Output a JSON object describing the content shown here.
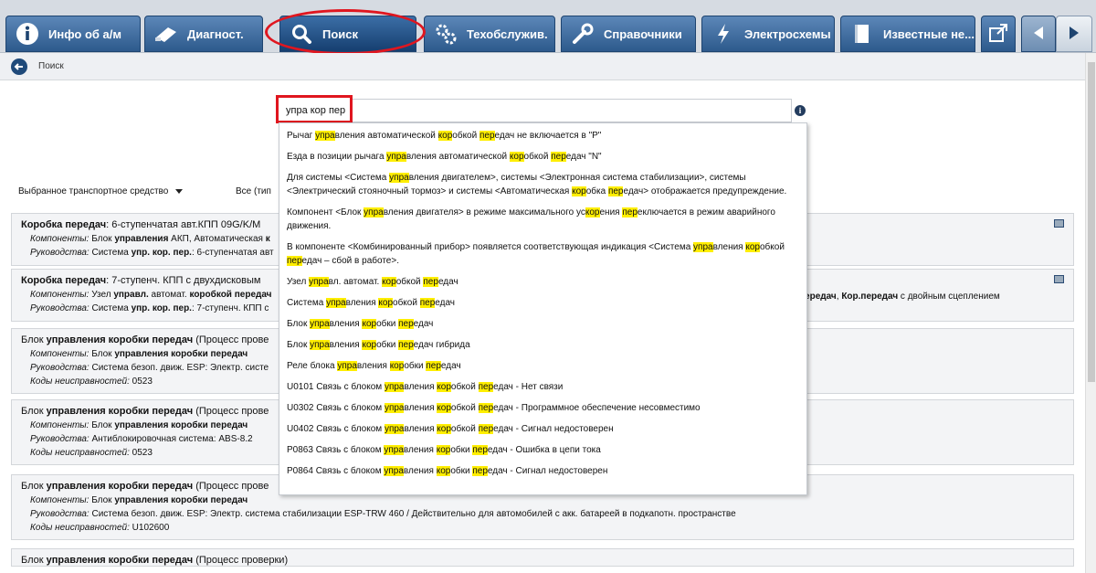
{
  "tabs": [
    {
      "id": "info",
      "label": "Инфо об а/м",
      "icon": "info-icon"
    },
    {
      "id": "diag",
      "label": "Диагност.",
      "icon": "diagnostic-connector-icon"
    },
    {
      "id": "search",
      "label": "Поиск",
      "icon": "search-icon",
      "active": true
    },
    {
      "id": "service",
      "label": "Техобслужив.",
      "icon": "gears-icon"
    },
    {
      "id": "refs",
      "label": "Справочники",
      "icon": "wrench-icon"
    },
    {
      "id": "wiring",
      "label": "Электросхемы",
      "icon": "lightning-icon"
    },
    {
      "id": "known",
      "label": "Известные не...",
      "icon": "book-icon"
    }
  ],
  "subbar": {
    "breadcrumb": "Поиск"
  },
  "search": {
    "value": "упра кор пер"
  },
  "filters": {
    "vehicle": "Выбранное транспортное средство",
    "type": "Все (тип"
  },
  "suggestions": [
    [
      [
        "Рычаг ",
        0
      ],
      [
        "упра",
        1
      ],
      [
        "вления автоматической ",
        0
      ],
      [
        "кор",
        1
      ],
      [
        "обкой ",
        0
      ],
      [
        "пер",
        1
      ],
      [
        "едач не включается в \"P\"",
        0
      ]
    ],
    [
      [
        "Езда в позиции рычага ",
        0
      ],
      [
        "упра",
        1
      ],
      [
        "вления автоматической ",
        0
      ],
      [
        "кор",
        1
      ],
      [
        "обкой ",
        0
      ],
      [
        "пер",
        1
      ],
      [
        "едач \"N\"",
        0
      ]
    ],
    [
      [
        "Для системы <Система ",
        0
      ],
      [
        "упра",
        1
      ],
      [
        "вления двигателем>, системы <Электронная система стабилизации>, системы <Электрический стояночный тормоз> и системы <Автоматическая ",
        0
      ],
      [
        "кор",
        1
      ],
      [
        "обка ",
        0
      ],
      [
        "пер",
        1
      ],
      [
        "едач> отображается предупреждение.",
        0
      ]
    ],
    [
      [
        "Компонент <Блок ",
        0
      ],
      [
        "упра",
        1
      ],
      [
        "вления двигателя> в режиме максимального ус",
        0
      ],
      [
        "кор",
        1
      ],
      [
        "ения ",
        0
      ],
      [
        "пер",
        1
      ],
      [
        "еключается в режим аварийного движения.",
        0
      ]
    ],
    [
      [
        "В компоненте <Комбинированный прибор> появляется соответствующая индикация <Система ",
        0
      ],
      [
        "упра",
        1
      ],
      [
        "вления ",
        0
      ],
      [
        "кор",
        1
      ],
      [
        "обкой ",
        0
      ],
      [
        "пер",
        1
      ],
      [
        "едач – сбой в работе>.",
        0
      ]
    ],
    [
      [
        "Узел ",
        0
      ],
      [
        "упра",
        1
      ],
      [
        "вл. автомат. ",
        0
      ],
      [
        "кор",
        1
      ],
      [
        "обкой ",
        0
      ],
      [
        "пер",
        1
      ],
      [
        "едач",
        0
      ]
    ],
    [
      [
        "Система ",
        0
      ],
      [
        "упра",
        1
      ],
      [
        "вления ",
        0
      ],
      [
        "кор",
        1
      ],
      [
        "обкой ",
        0
      ],
      [
        "пер",
        1
      ],
      [
        "едач",
        0
      ]
    ],
    [
      [
        "Блок ",
        0
      ],
      [
        "упра",
        1
      ],
      [
        "вления ",
        0
      ],
      [
        "кор",
        1
      ],
      [
        "обки ",
        0
      ],
      [
        "пер",
        1
      ],
      [
        "едач",
        0
      ]
    ],
    [
      [
        "Блок ",
        0
      ],
      [
        "упра",
        1
      ],
      [
        "вления ",
        0
      ],
      [
        "кор",
        1
      ],
      [
        "обки ",
        0
      ],
      [
        "пер",
        1
      ],
      [
        "едач гибрида",
        0
      ]
    ],
    [
      [
        "Реле блока ",
        0
      ],
      [
        "упра",
        1
      ],
      [
        "вления ",
        0
      ],
      [
        "кор",
        1
      ],
      [
        "обки ",
        0
      ],
      [
        "пер",
        1
      ],
      [
        "едач",
        0
      ]
    ],
    [
      [
        "U0101 Связь с блоком ",
        0
      ],
      [
        "упра",
        1
      ],
      [
        "вления ",
        0
      ],
      [
        "кор",
        1
      ],
      [
        "обкой ",
        0
      ],
      [
        "пер",
        1
      ],
      [
        "едач - Нет связи",
        0
      ]
    ],
    [
      [
        "U0302 Связь с блоком ",
        0
      ],
      [
        "упра",
        1
      ],
      [
        "вления ",
        0
      ],
      [
        "кор",
        1
      ],
      [
        "обкой ",
        0
      ],
      [
        "пер",
        1
      ],
      [
        "едач - Программное обеспечение несовместимо",
        0
      ]
    ],
    [
      [
        "U0402 Связь с блоком ",
        0
      ],
      [
        "упра",
        1
      ],
      [
        "вления ",
        0
      ],
      [
        "кор",
        1
      ],
      [
        "обкой ",
        0
      ],
      [
        "пер",
        1
      ],
      [
        "едач - Сигнал недостоверен",
        0
      ]
    ],
    [
      [
        "P0863 Связь с блоком ",
        0
      ],
      [
        "упра",
        1
      ],
      [
        "вления ",
        0
      ],
      [
        "кор",
        1
      ],
      [
        "обки ",
        0
      ],
      [
        "пер",
        1
      ],
      [
        "едач - Ошибка в цепи тока",
        0
      ]
    ],
    [
      [
        "P0864 Связь с блоком ",
        0
      ],
      [
        "упра",
        1
      ],
      [
        "вления ",
        0
      ],
      [
        "кор",
        1
      ],
      [
        "обки ",
        0
      ],
      [
        "пер",
        1
      ],
      [
        "едач - Сигнал недостоверен",
        0
      ]
    ]
  ],
  "results": [
    {
      "title": [
        [
          "Коробка передач",
          1
        ],
        [
          ": 6-ступенчатая авт.КПП 09G/K/M",
          0
        ]
      ],
      "lines": [
        [
          [
            "Компоненты:",
            2
          ],
          [
            " Блок ",
            0
          ],
          [
            "управления",
            1
          ],
          [
            " АКП, Автоматическая ",
            0
          ],
          [
            "к",
            1
          ]
        ],
        [
          [
            "Руководства:",
            2
          ],
          [
            " Система ",
            0
          ],
          [
            "упр. кор. пер.",
            1
          ],
          [
            ": 6-ступенчатая авт",
            0
          ]
        ]
      ],
      "image": true
    },
    {
      "title": [
        [
          "Коробка передач",
          1
        ],
        [
          ": 7-ступенч. КПП с двухдисковым",
          0
        ]
      ],
      "lines": [
        [
          [
            "Компоненты:",
            2
          ],
          [
            " Узел ",
            0
          ],
          [
            "управл.",
            1
          ],
          [
            " автомат. ",
            0
          ],
          [
            "коробкой передач",
            1
          ]
        ],
        [
          [
            "Руководства:",
            2
          ],
          [
            " Система ",
            0
          ],
          [
            "упр. кор. пер.",
            1
          ],
          [
            ": 7-ступенч. КПП с",
            0
          ]
        ]
      ],
      "tail": [
        [
          "передач",
          1
        ],
        [
          ", ",
          0
        ],
        [
          "Кор.передач",
          1
        ],
        [
          " с двойным сцеплением",
          0
        ]
      ],
      "image": true
    },
    {
      "title": [
        [
          "Блок ",
          0
        ],
        [
          "управления коробки передач",
          1
        ],
        [
          " (Процесс прове",
          0
        ]
      ],
      "lines": [
        [
          [
            "Компоненты:",
            2
          ],
          [
            " Блок ",
            0
          ],
          [
            "управления коробки передач",
            1
          ]
        ],
        [
          [
            "Руководства:",
            2
          ],
          [
            " Система безоп. движ. ESP: Электр. систе",
            0
          ]
        ],
        [
          [
            "Коды неисправностей:",
            2
          ],
          [
            " 0523",
            0
          ]
        ]
      ]
    },
    {
      "title": [
        [
          "Блок ",
          0
        ],
        [
          "управления коробки передач",
          1
        ],
        [
          " (Процесс прове",
          0
        ]
      ],
      "lines": [
        [
          [
            "Компоненты:",
            2
          ],
          [
            " Блок ",
            0
          ],
          [
            "управления коробки передач",
            1
          ]
        ],
        [
          [
            "Руководства:",
            2
          ],
          [
            " Антиблокировочная система: ABS-8.2",
            0
          ]
        ],
        [
          [
            "Коды неисправностей:",
            2
          ],
          [
            " 0523",
            0
          ]
        ]
      ]
    },
    {
      "title": [
        [
          "Блок ",
          0
        ],
        [
          "управления коробки передач",
          1
        ],
        [
          " (Процесс прове",
          0
        ]
      ],
      "lines": [
        [
          [
            "Компоненты:",
            2
          ],
          [
            " Блок ",
            0
          ],
          [
            "управления коробки передач",
            1
          ]
        ],
        [
          [
            "Руководства:",
            2
          ],
          [
            " Система безоп. движ. ESP: Электр. система стабилизации ESP-TRW 460 / Действительно для автомобилей с акк. батареей в подкапотн. пространстве",
            0
          ]
        ],
        [
          [
            "Коды неисправностей:",
            2
          ],
          [
            " U102600",
            0
          ]
        ]
      ]
    },
    {
      "title": [
        [
          "Блок ",
          0
        ],
        [
          "управления коробки передач",
          1
        ],
        [
          " (Процесс проверки)",
          0
        ]
      ],
      "lines": []
    }
  ],
  "colors": {
    "tab": "#2d5a8c",
    "highlight": "#ffee00",
    "annotation": "#e0161f"
  }
}
